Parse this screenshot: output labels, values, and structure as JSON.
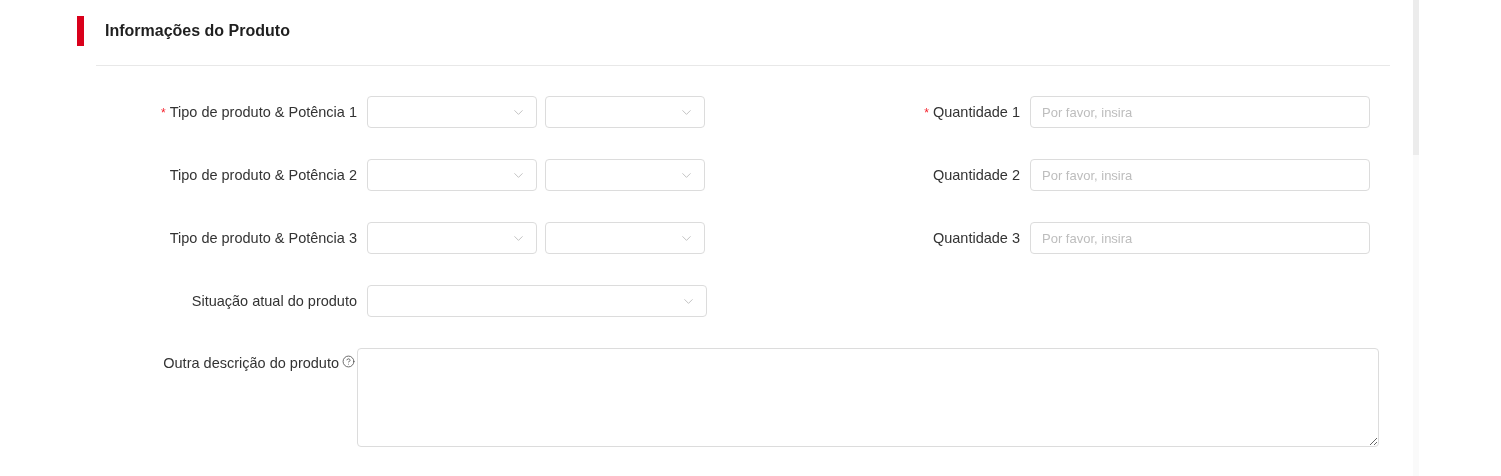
{
  "section": {
    "title": "Informações do Produto"
  },
  "rows": [
    {
      "product": {
        "label": "Tipo de produto & Potência 1",
        "asterisk": "*"
      },
      "quantity": {
        "label": "Quantidade 1",
        "asterisk": "*",
        "placeholder": "Por favor, insira"
      }
    },
    {
      "product": {
        "label": "Tipo de produto & Potência 2"
      },
      "quantity": {
        "label": "Quantidade 2",
        "placeholder": "Por favor, insira"
      }
    },
    {
      "product": {
        "label": "Tipo de produto & Potência 3"
      },
      "quantity": {
        "label": "Quantidade 3",
        "placeholder": "Por favor, insira"
      }
    }
  ],
  "status": {
    "label": "Situação atual do produto"
  },
  "description": {
    "label": "Outra descrição do produto"
  }
}
